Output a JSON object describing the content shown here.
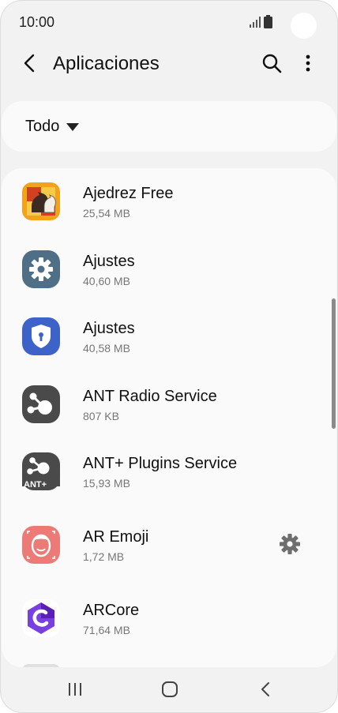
{
  "status_bar": {
    "time": "10:00"
  },
  "header": {
    "title": "Aplicaciones"
  },
  "filter": {
    "label": "Todo"
  },
  "apps": [
    {
      "name": "Ajedrez Free",
      "size": "25,54 MB",
      "icon": "chess-app-icon"
    },
    {
      "name": "Ajustes",
      "size": "40,60 MB",
      "icon": "settings-gear-icon"
    },
    {
      "name": "Ajustes",
      "size": "40,58 MB",
      "icon": "security-shield-icon"
    },
    {
      "name": "ANT Radio Service",
      "size": "807 KB",
      "icon": "ant-radio-icon"
    },
    {
      "name": "ANT+ Plugins Service",
      "size": "15,93 MB",
      "icon": "ant-plugins-icon"
    },
    {
      "name": "AR Emoji",
      "size": "1,72 MB",
      "icon": "ar-emoji-icon"
    },
    {
      "name": "ARCore",
      "size": "71,64 MB",
      "icon": "arcore-icon"
    }
  ],
  "colors": {
    "background": "#f2f2f2",
    "card": "#fafafa",
    "settings_icon": "#4f6f86",
    "shield_icon": "#3e63c8",
    "ant_icon": "#4a4a4a",
    "ar_emoji_icon": "#ec7b78",
    "arcore_icon": "#6b2bd0"
  }
}
